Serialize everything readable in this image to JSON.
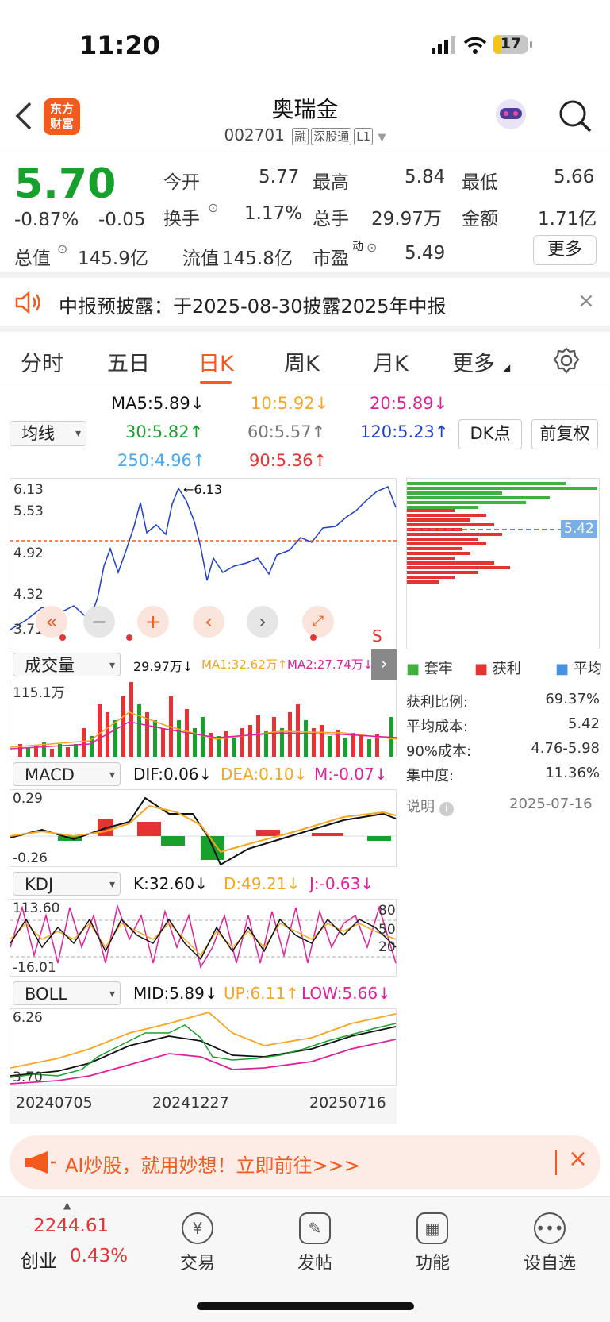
{
  "status_bar": {
    "time": "11:20",
    "battery": "17"
  },
  "header": {
    "logo_line1": "东方",
    "logo_line2": "财富",
    "title": "奥瑞金",
    "code": "002701",
    "tags": [
      "融",
      "深股通",
      "L1"
    ]
  },
  "quote": {
    "price": "5.70",
    "change_pct": "-0.87%",
    "change": "-0.05",
    "open_label": "今开",
    "open": "5.77",
    "high_label": "最高",
    "high": "5.84",
    "low_label": "最低",
    "low": "5.66",
    "turnover_label": "换手",
    "turnover": "1.17%",
    "volume_label": "总手",
    "volume": "29.97万",
    "amount_label": "金额",
    "amount": "1.71亿",
    "mktcap_label": "总值",
    "mktcap": "145.9亿",
    "float_label": "流值",
    "float": "145.8亿",
    "pe_label": "市盈",
    "pe_sup": "动",
    "pe": "5.49",
    "more_label": "更多"
  },
  "notice": {
    "text": "中报预披露：于2025-08-30披露2025年中报"
  },
  "tabs": [
    "分时",
    "五日",
    "日K",
    "周K",
    "月K",
    "更多"
  ],
  "active_tab": "日K",
  "ma_row": {
    "ma5": "MA5:5.89",
    "ma10": "10:5.92",
    "ma20": "20:5.89",
    "ma30": "30:5.82",
    "ma60": "60:5.57",
    "ma120": "120:5.23",
    "ma250": "250:4.96",
    "ma90": "90:5.36",
    "selector": "均线",
    "dk_label": "DK点",
    "adjust_label": "前复权"
  },
  "kline": {
    "y_labels": [
      "6.13",
      "5.53",
      "4.92",
      "4.32",
      "3.71"
    ],
    "max_mark": "6.13",
    "s_label": "S",
    "cost_value": "5.42"
  },
  "cost_legend": {
    "trapped": "套牢",
    "profit": "获利",
    "average": "平均"
  },
  "cost_stats": [
    {
      "label": "获利比例:",
      "value": "69.37%"
    },
    {
      "label": "平均成本:",
      "value": "5.42"
    },
    {
      "label": "90%成本:",
      "value": "4.76-5.98"
    },
    {
      "label": "集中度:",
      "value": "11.36%"
    }
  ],
  "cost_note": {
    "label": "说明",
    "date": "2025-07-16"
  },
  "volume": {
    "selector": "成交量",
    "val": "29.97万",
    "ma1": "MA1:32.62万",
    "ma2": "MA2:27.74万",
    "top": "115.1万"
  },
  "macd": {
    "selector": "MACD",
    "dif": "DIF:0.06",
    "dea": "DEA:0.10",
    "m": "M:-0.07",
    "top": "0.29",
    "bottom": "-0.26"
  },
  "kdj": {
    "selector": "KDJ",
    "k": "K:32.60",
    "d": "D:49.21",
    "j": "J:-0.63",
    "top": "113.60",
    "bottom": "-16.01",
    "r80": "80",
    "r50": "50",
    "r20": "20"
  },
  "boll": {
    "selector": "BOLL",
    "mid": "MID:5.89",
    "up": "UP:6.11",
    "low": "LOW:5.66",
    "top": "6.26",
    "bottom": "3.70"
  },
  "dates": [
    "20240705",
    "20241227",
    "20250716"
  ],
  "ad": {
    "text": "AI炒股，就用妙想！立即前往>>>"
  },
  "bottom_nav": {
    "index_value": "2244.61",
    "index_name": "创业",
    "index_change": "0.43%",
    "items": [
      "交易",
      "发帖",
      "功能",
      "设自选"
    ]
  },
  "colors": {
    "accent": "#f25a1e",
    "up": "#e63232",
    "down": "#17a02c",
    "ma10": "#f5a623",
    "ma20": "#e0209a",
    "ma120": "#1e40c8",
    "ma250": "#4aa8ef"
  }
}
